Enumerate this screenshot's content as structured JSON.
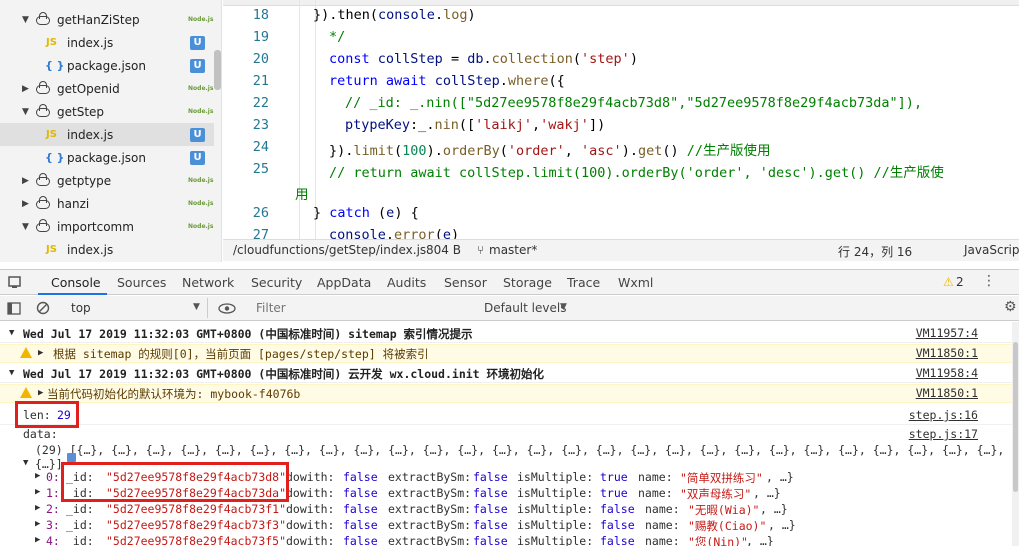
{
  "file_tree": {
    "items": [
      {
        "label": "getHanZiStep",
        "kind": "folder",
        "badge": "Node.js"
      },
      {
        "label": "index.js",
        "kind": "js",
        "badge": "U"
      },
      {
        "label": "package.json",
        "kind": "json",
        "badge": "U"
      },
      {
        "label": "getOpenid",
        "kind": "folder",
        "badge": "Node.js"
      },
      {
        "label": "getStep",
        "kind": "folder",
        "badge": "Node.js"
      },
      {
        "label": "index.js",
        "kind": "js",
        "badge": "U"
      },
      {
        "label": "package.json",
        "kind": "json",
        "badge": "U"
      },
      {
        "label": "getptype",
        "kind": "folder",
        "badge": "Node.js"
      },
      {
        "label": "hanzi",
        "kind": "folder",
        "badge": "Node.js"
      },
      {
        "label": "importcomm",
        "kind": "folder",
        "badge": "Node.js"
      },
      {
        "label": "index.js",
        "kind": "js",
        "badge": ""
      }
    ]
  },
  "editor": {
    "line_numbers": [
      "18",
      "19",
      "20",
      "21",
      "22",
      "23",
      "24",
      "25",
      "",
      "26",
      "27"
    ],
    "wrap_tail": "用"
  },
  "statusbar": {
    "path": "/cloudfunctions/getStep/index.js",
    "size": "804 B",
    "branch": "master*",
    "position": "行 24，列 16",
    "language": "JavaScript"
  },
  "devtools": {
    "tabs": [
      "Console",
      "Sources",
      "Network",
      "Security",
      "AppData",
      "Audits",
      "Sensor",
      "Storage",
      "Trace",
      "Wxml"
    ],
    "warning_count": "2",
    "context": "top",
    "filter_placeholder": "Filter",
    "levels": "Default levels"
  },
  "console": {
    "entries": [
      {
        "text": "Wed Jul 17 2019 11:32:03 GMT+0800 (中国标准时间) sitemap 索引情况提示",
        "source": "VM11957:4"
      },
      {
        "text": "根据 sitemap 的规则[0]，当前页面 [pages/step/step] 将被索引",
        "source": "VM11850:1"
      },
      {
        "text": "Wed Jul 17 2019 11:32:03 GMT+0800 (中国标准时间) 云开发 wx.cloud.init 环境初始化",
        "source": "VM11958:4"
      },
      {
        "text": "当前代码初始化的默认环境为: mybook-f4076b",
        "source": "VM11850:1"
      },
      {
        "label": "len:",
        "value": "29",
        "source": "step.js:16"
      },
      {
        "label": "data:",
        "source": "step.js:17"
      }
    ],
    "array_summary": "(29) [{…}, {…}, {…}, {…}, {…}, {…}, {…}, {…}, {…}, {…}, {…}, {…}, {…}, {…}, {…}, {…}, {…}, {…}, {…}, {…}, {…}, {…}, {…}, {…}, {…}, {…}, {…}, {…},",
    "array_tail": "{…}]",
    "rows": [
      {
        "index": "0:",
        "id": "\"5d27ee9578f8e29f4acb73d8\"",
        "isMultiple": "true",
        "name": "\"简单双拼练习\""
      },
      {
        "index": "1:",
        "id": "\"5d27ee9578f8e29f4acb73da\"",
        "isMultiple": "true",
        "name": "\"双声母练习\""
      },
      {
        "index": "2:",
        "id": "\"5d27ee9578f8e29f4acb73f1\"",
        "isMultiple": "false",
        "name": "\"无暇(Wia)\""
      },
      {
        "index": "3:",
        "id": "\"5d27ee9578f8e29f4acb73f3\"",
        "isMultiple": "false",
        "name": "\"赐教(Ciao)\""
      },
      {
        "index": "4:",
        "id": "\"5d27ee9578f8e29f4acb73f5\"",
        "isMultiple": "false",
        "name": "\"您(Nin)\""
      }
    ],
    "field_labels": {
      "id": "_id:",
      "dowith": "dowith:",
      "extract": "extractBySm:",
      "multiple": "isMultiple:",
      "name": "name:"
    },
    "false_literal": "false",
    "ellipsis": ", …}"
  }
}
